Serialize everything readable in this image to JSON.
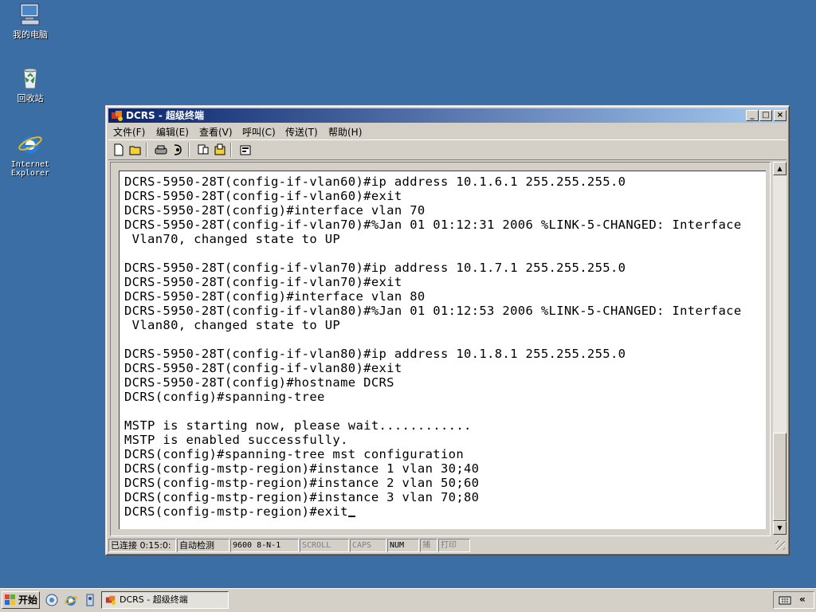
{
  "desktop": {
    "icons": [
      {
        "label": "我的电脑",
        "icon": "my-computer-icon"
      },
      {
        "label": "回收站",
        "icon": "recycle-bin-icon"
      },
      {
        "label": "Internet Explorer",
        "icon": "internet-explorer-icon"
      }
    ],
    "background_color": "#3a6ea5"
  },
  "window": {
    "title": "DCRS - 超级终端",
    "menu": [
      "文件(F)",
      "编辑(E)",
      "查看(V)",
      "呼叫(C)",
      "传送(T)",
      "帮助(H)"
    ],
    "toolbar_icons": [
      "new-icon",
      "open-icon",
      "disconnect-icon",
      "dial-icon",
      "send-icon",
      "receive-icon",
      "properties-icon"
    ],
    "terminal_lines": [
      "DCRS-5950-28T(config-if-vlan60)#ip address 10.1.6.1 255.255.255.0",
      "DCRS-5950-28T(config-if-vlan60)#exit",
      "DCRS-5950-28T(config)#interface vlan 70",
      "DCRS-5950-28T(config-if-vlan70)#%Jan 01 01:12:31 2006 %LINK-5-CHANGED: Interface",
      " Vlan70, changed state to UP",
      "",
      "DCRS-5950-28T(config-if-vlan70)#ip address 10.1.7.1 255.255.255.0",
      "DCRS-5950-28T(config-if-vlan70)#exit",
      "DCRS-5950-28T(config)#interface vlan 80",
      "DCRS-5950-28T(config-if-vlan80)#%Jan 01 01:12:53 2006 %LINK-5-CHANGED: Interface",
      " Vlan80, changed state to UP",
      "",
      "DCRS-5950-28T(config-if-vlan80)#ip address 10.1.8.1 255.255.255.0",
      "DCRS-5950-28T(config-if-vlan80)#exit",
      "DCRS-5950-28T(config)#hostname DCRS",
      "DCRS(config)#spanning-tree",
      "",
      "MSTP is starting now, please wait............",
      "MSTP is enabled successfully.",
      "DCRS(config)#spanning-tree mst configuration",
      "DCRS(config-mstp-region)#instance 1 vlan 30;40",
      "DCRS(config-mstp-region)#instance 2 vlan 50;60",
      "DCRS(config-mstp-region)#instance 3 vlan 70;80",
      "DCRS(config-mstp-region)#exit"
    ],
    "status": {
      "connected": "已连接 0:15:0:",
      "detect": "自动检测",
      "port": "9600 8-N-1",
      "scroll": "SCROLL",
      "caps": "CAPS",
      "num": "NUM",
      "capture": "捕",
      "print": "打印"
    }
  },
  "taskbar": {
    "start_label": "开始",
    "quicklaunch": [
      "show-desktop-icon",
      "internet-explorer-icon",
      "outlook-icon"
    ],
    "task": "DCRS - 超级终端"
  }
}
